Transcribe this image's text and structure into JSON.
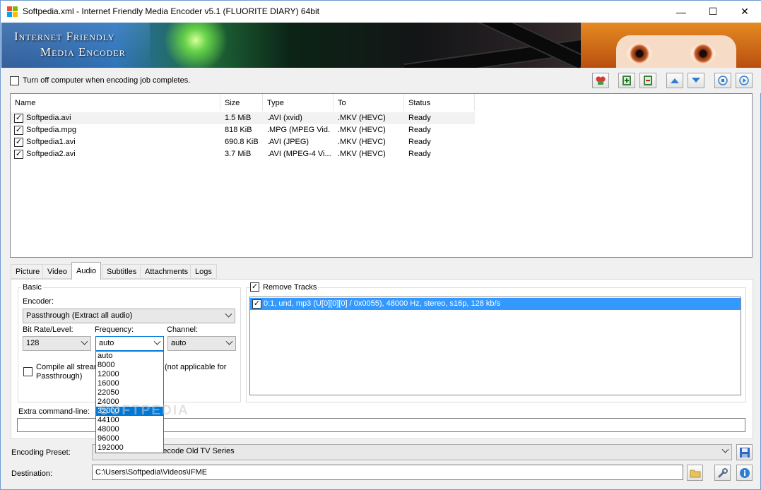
{
  "window": {
    "title": "Softpedia.xml - Internet Friendly Media Encoder v5.1 (FLUORITE DIARY) 64bit",
    "minimize_glyph": "—",
    "maximize_glyph": "☐",
    "close_glyph": "✕"
  },
  "banner": {
    "line1": "Internet Friendly",
    "line2": "Media Encoder"
  },
  "options": {
    "shutdown_label": "Turn off computer when encoding job completes.",
    "shutdown_checked": false
  },
  "toolbar": {
    "icons": [
      "donate-heart-icon",
      "add-file-icon",
      "remove-file-icon",
      "move-up-icon",
      "move-down-icon",
      "stop-icon",
      "start-icon"
    ]
  },
  "queue": {
    "columns": [
      "Name",
      "Size",
      "Type",
      "To",
      "Status"
    ],
    "rows": [
      {
        "name": "Softpedia.avi",
        "size": "1.5 MiB",
        "type": ".AVI (xvid)",
        "to": ".MKV (HEVC)",
        "status": "Ready",
        "checked": true
      },
      {
        "name": "Softpedia.mpg",
        "size": "818 KiB",
        "type": ".MPG (MPEG Vid...",
        "to": ".MKV (HEVC)",
        "status": "Ready",
        "checked": true
      },
      {
        "name": "Softpedia1.avi",
        "size": "690.8 KiB",
        "type": ".AVI (JPEG)",
        "to": ".MKV (HEVC)",
        "status": "Ready",
        "checked": true
      },
      {
        "name": "Softpedia2.avi",
        "size": "3.7 MiB",
        "type": ".AVI (MPEG-4 Vi...",
        "to": ".MKV (HEVC)",
        "status": "Ready",
        "checked": true
      }
    ]
  },
  "tabs": {
    "items": [
      "Picture",
      "Video",
      "Audio",
      "Subtitles",
      "Attachments",
      "Logs"
    ],
    "active": "Audio"
  },
  "audio": {
    "basic_group": "Basic",
    "encoder_label": "Encoder:",
    "encoder_value": "Passthrough (Extract all audio)",
    "bitrate_label": "Bit Rate/Level:",
    "bitrate_value": "128",
    "frequency_label": "Frequency:",
    "frequency_value": "auto",
    "channel_label": "Channel:",
    "channel_value": "auto",
    "compile_label_a": "Compile all stream",
    "compile_label_b": "(not applicable for",
    "compile_label_c": "Passthrough)",
    "compile_checked": false,
    "frequency_options": [
      "auto",
      "8000",
      "12000",
      "16000",
      "22050",
      "24000",
      "32000",
      "44100",
      "48000",
      "96000",
      "192000"
    ],
    "frequency_highlighted": "32000",
    "remove_tracks_label": "Remove Tracks",
    "remove_tracks_checked": true,
    "tracks": [
      {
        "label": "0:1, und, mp3 (U[0][0][0] / 0x0055), 48000 Hz, stereo, s16p, 128 kb/s",
        "checked": true
      }
    ],
    "extra_cmd_label": "Extra command-line:",
    "extra_cmd_value": ""
  },
  "preset": {
    "label": "Encoding Preset:",
    "value": "User: MKV Batch Recode Old TV Series"
  },
  "destination": {
    "label": "Destination:",
    "value": "C:\\Users\\Softpedia\\Videos\\IFME"
  },
  "watermark": "SOFTPEDIA",
  "colors": {
    "selection": "#3399ff",
    "dropdown_highlight": "#0078d7",
    "window_bg": "#f0f0f0"
  }
}
